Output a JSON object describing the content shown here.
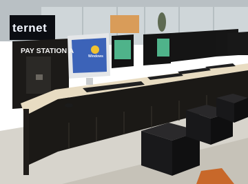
{
  "scene": {
    "photo_label": "",
    "signage": {
      "text": "ternet",
      "color": "#f2f6ff",
      "background": "#0b0d12"
    },
    "kiosk": {
      "label": "PAY STATION A",
      "body_color": "#1c1a18"
    },
    "monitor_screen": {
      "text": "Windows"
    },
    "colors": {
      "counter_top": "#e8dcc2",
      "cabinet": "#1b1916",
      "stool": "#19191b",
      "floor": "#d7d4cc",
      "screen_green": "#4fb38a"
    }
  }
}
